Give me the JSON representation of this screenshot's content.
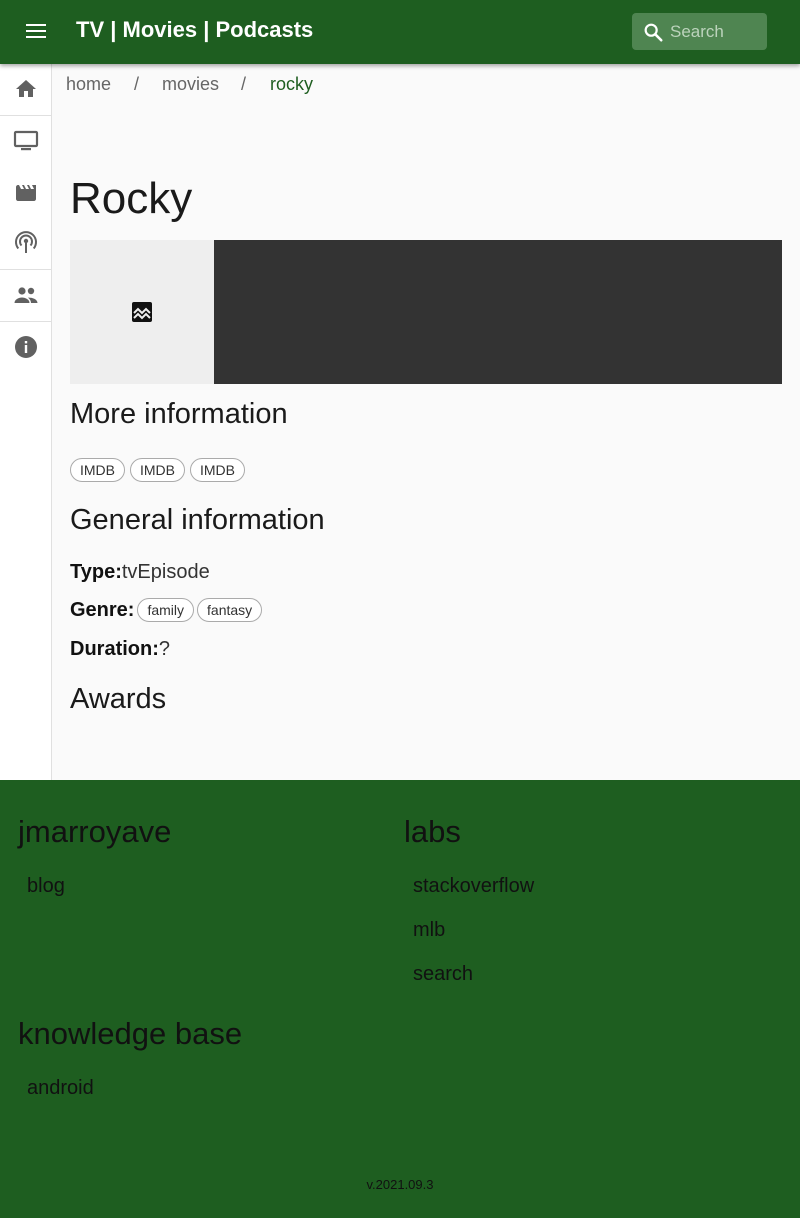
{
  "appbar": {
    "title": "TV | Movies | Podcasts",
    "search_placeholder": "Search"
  },
  "rail": [
    {
      "icon": "home-icon"
    },
    {
      "icon": "tv-icon"
    },
    {
      "icon": "movie-icon"
    },
    {
      "icon": "podcast-icon"
    },
    {
      "icon": "people-icon"
    },
    {
      "icon": "info-icon"
    }
  ],
  "breadcrumb": {
    "items": [
      "home",
      "movies",
      "rocky"
    ],
    "separator": "/"
  },
  "page": {
    "title": "Rocky",
    "more_info_heading": "More information",
    "links": [
      "IMDB",
      "IMDB",
      "IMDB"
    ],
    "general_heading": "General information",
    "type_label": "Type:",
    "type_value": "tvEpisode",
    "genre_label": "Genre:",
    "genres": [
      "family",
      "fantasy"
    ],
    "duration_label": "Duration:",
    "duration_value": "?",
    "awards_heading": "Awards"
  },
  "footer": {
    "sections": [
      {
        "title": "jmarroyave",
        "links": [
          "blog"
        ]
      },
      {
        "title": "labs",
        "links": [
          "stackoverflow",
          "mlb",
          "search"
        ]
      },
      {
        "title": "knowledge base",
        "links": [
          "android"
        ]
      }
    ],
    "version": "v.2021.09.3"
  },
  "colors": {
    "primary": "#1e5e20",
    "search_bg": "#4f8551",
    "media_bg": "#333333",
    "content_bg": "#fafafa"
  }
}
